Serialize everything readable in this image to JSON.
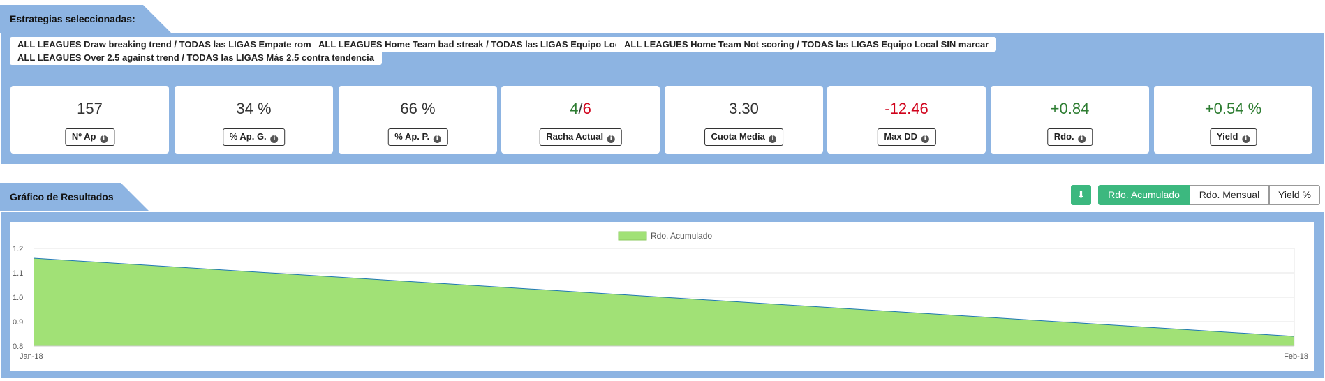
{
  "strategies": {
    "title": "Estrategias seleccionadas:",
    "chips": [
      "ALL LEAGUES Draw breaking trend / TODAS las LIGAS Empate rompiendo racha",
      "ALL LEAGUES Home Team bad streak / TODAS las LIGAS Equipo Local mala racha",
      "ALL LEAGUES Home Team Not scoring / TODAS las LIGAS Equipo Local SIN marcar",
      "ALL LEAGUES Over 2.5 against trend / TODAS las LIGAS Más 2.5 contra tendencia"
    ]
  },
  "stats": [
    {
      "value": "157",
      "label": "Nº Ap"
    },
    {
      "value": "34 %",
      "label": "% Ap. G."
    },
    {
      "value": "66 %",
      "label": "% Ap. P."
    },
    {
      "value_win": "4",
      "value_sep": "/",
      "value_loss": "6",
      "label": "Racha Actual"
    },
    {
      "value": "3.30",
      "label": "Cuota Media"
    },
    {
      "value": "-12.46",
      "label": "Max DD"
    },
    {
      "value": "+0.84",
      "label": "Rdo."
    },
    {
      "value": "+0.54 %",
      "label": "Yield"
    }
  ],
  "info_icon_glyph": "i",
  "chart_section": {
    "title": "Gráfico de Resultados",
    "buttons": {
      "download_glyph": "⬇",
      "acumulado": "Rdo. Acumulado",
      "mensual": "Rdo. Mensual",
      "yield": "Yield %"
    },
    "active_button": "acumulado"
  },
  "colors": {
    "panel": "#8db4e2",
    "accent_green": "#3cb87f",
    "area_fill": "#a1e176",
    "line": "#1f77b4",
    "positive": "#2e7d32",
    "negative": "#d0021b"
  },
  "chart_data": {
    "type": "area",
    "x": [
      "Jan-18",
      "Feb-18"
    ],
    "series": [
      {
        "name": "Rdo. Acumulado",
        "values": [
          1.16,
          0.84
        ]
      }
    ],
    "ylim": [
      0.8,
      1.2
    ],
    "yticks": [
      "0.8",
      "0.9",
      "1.0",
      "1.1",
      "1.2"
    ],
    "legend": "top-center",
    "grid": true
  }
}
